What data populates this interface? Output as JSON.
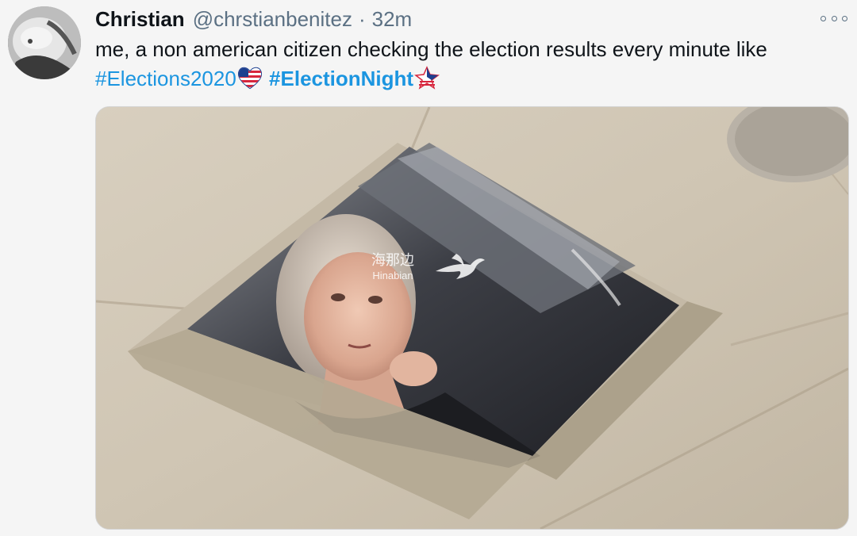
{
  "tweet": {
    "display_name": "Christian",
    "handle": "@chrstianbenitez",
    "separator": "·",
    "time": "32m",
    "text_main": "me, a non american citizen checking the election results every minute like ",
    "hashtag1": "#Elections2020",
    "hashtag2": "#ElectionNight",
    "more_icon": "more-options-icon",
    "avatar_icon": "avatar"
  },
  "media": {
    "watermark_cn": "海那边",
    "watermark_en": "Hinabian"
  },
  "colors": {
    "link": "#1b95e0",
    "secondary": "#5b7083",
    "primary": "#0f1419",
    "background": "#f5f5f5"
  }
}
